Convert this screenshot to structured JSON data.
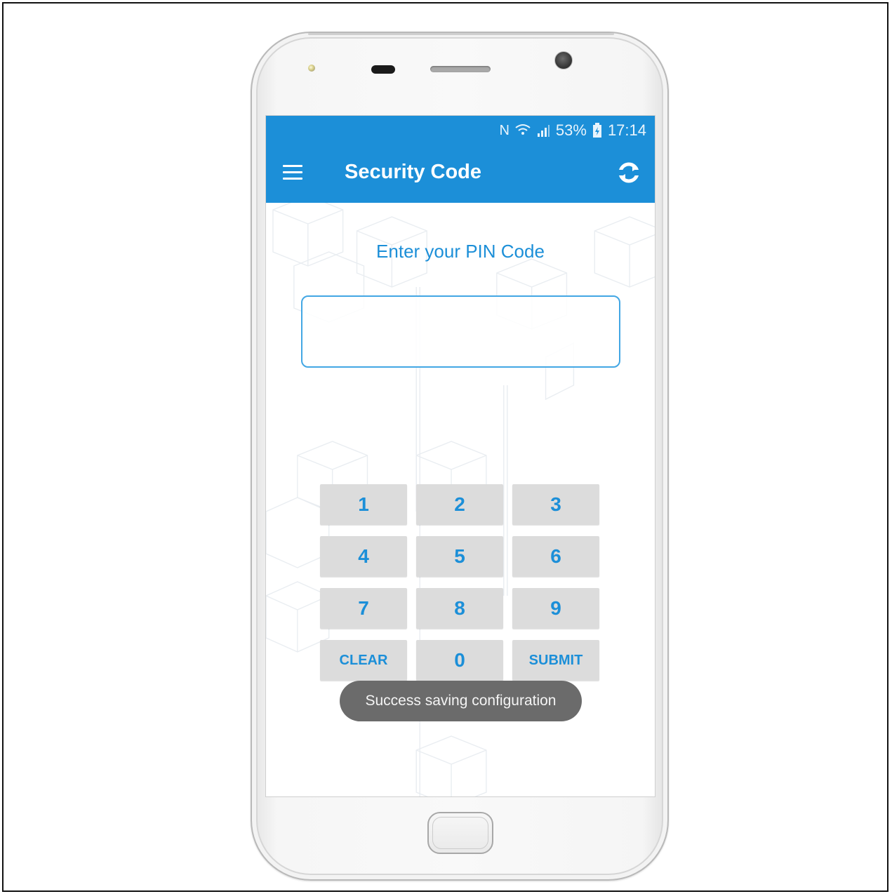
{
  "status_bar": {
    "nfc_icon": "N",
    "wifi_icon": "wifi-icon",
    "signal_icon": "signal-icon",
    "battery_percent": "53%",
    "battery_icon": "battery-charging-icon",
    "time": "17:14"
  },
  "app_bar": {
    "menu_icon": "hamburger-menu-icon",
    "title": "Security Code",
    "sync_icon": "sync-icon"
  },
  "pin_entry": {
    "prompt": "Enter your PIN Code",
    "value": ""
  },
  "keypad": {
    "keys": [
      "1",
      "2",
      "3",
      "4",
      "5",
      "6",
      "7",
      "8",
      "9",
      "CLEAR",
      "0",
      "SUBMIT"
    ]
  },
  "toast": {
    "message": "Success saving configuration"
  },
  "colors": {
    "accent": "#1c8fd8",
    "key_background": "#dcdcdc",
    "toast_background": "#6b6b6b"
  }
}
